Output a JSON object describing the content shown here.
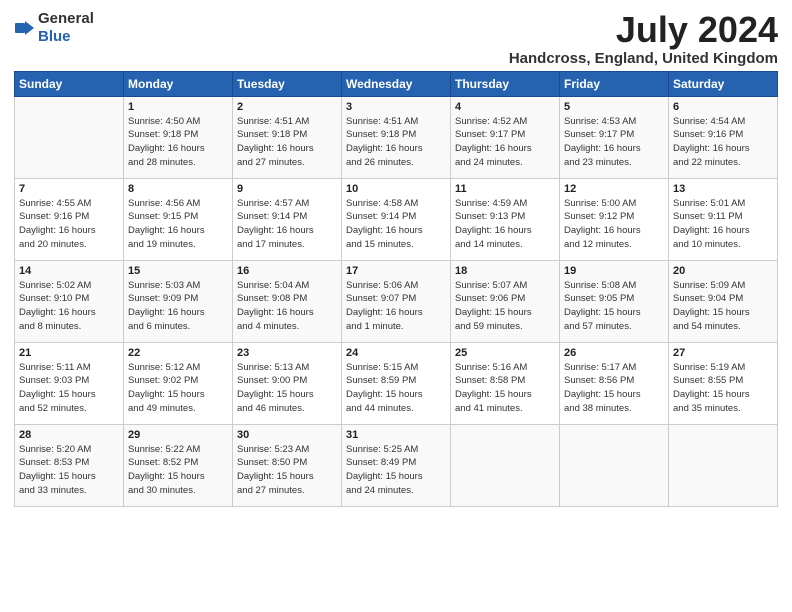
{
  "header": {
    "logo_general": "General",
    "logo_blue": "Blue",
    "title": "July 2024",
    "location": "Handcross, England, United Kingdom"
  },
  "columns": [
    "Sunday",
    "Monday",
    "Tuesday",
    "Wednesday",
    "Thursday",
    "Friday",
    "Saturday"
  ],
  "weeks": [
    [
      {
        "day": "",
        "info": ""
      },
      {
        "day": "1",
        "info": "Sunrise: 4:50 AM\nSunset: 9:18 PM\nDaylight: 16 hours\nand 28 minutes."
      },
      {
        "day": "2",
        "info": "Sunrise: 4:51 AM\nSunset: 9:18 PM\nDaylight: 16 hours\nand 27 minutes."
      },
      {
        "day": "3",
        "info": "Sunrise: 4:51 AM\nSunset: 9:18 PM\nDaylight: 16 hours\nand 26 minutes."
      },
      {
        "day": "4",
        "info": "Sunrise: 4:52 AM\nSunset: 9:17 PM\nDaylight: 16 hours\nand 24 minutes."
      },
      {
        "day": "5",
        "info": "Sunrise: 4:53 AM\nSunset: 9:17 PM\nDaylight: 16 hours\nand 23 minutes."
      },
      {
        "day": "6",
        "info": "Sunrise: 4:54 AM\nSunset: 9:16 PM\nDaylight: 16 hours\nand 22 minutes."
      }
    ],
    [
      {
        "day": "7",
        "info": "Sunrise: 4:55 AM\nSunset: 9:16 PM\nDaylight: 16 hours\nand 20 minutes."
      },
      {
        "day": "8",
        "info": "Sunrise: 4:56 AM\nSunset: 9:15 PM\nDaylight: 16 hours\nand 19 minutes."
      },
      {
        "day": "9",
        "info": "Sunrise: 4:57 AM\nSunset: 9:14 PM\nDaylight: 16 hours\nand 17 minutes."
      },
      {
        "day": "10",
        "info": "Sunrise: 4:58 AM\nSunset: 9:14 PM\nDaylight: 16 hours\nand 15 minutes."
      },
      {
        "day": "11",
        "info": "Sunrise: 4:59 AM\nSunset: 9:13 PM\nDaylight: 16 hours\nand 14 minutes."
      },
      {
        "day": "12",
        "info": "Sunrise: 5:00 AM\nSunset: 9:12 PM\nDaylight: 16 hours\nand 12 minutes."
      },
      {
        "day": "13",
        "info": "Sunrise: 5:01 AM\nSunset: 9:11 PM\nDaylight: 16 hours\nand 10 minutes."
      }
    ],
    [
      {
        "day": "14",
        "info": "Sunrise: 5:02 AM\nSunset: 9:10 PM\nDaylight: 16 hours\nand 8 minutes."
      },
      {
        "day": "15",
        "info": "Sunrise: 5:03 AM\nSunset: 9:09 PM\nDaylight: 16 hours\nand 6 minutes."
      },
      {
        "day": "16",
        "info": "Sunrise: 5:04 AM\nSunset: 9:08 PM\nDaylight: 16 hours\nand 4 minutes."
      },
      {
        "day": "17",
        "info": "Sunrise: 5:06 AM\nSunset: 9:07 PM\nDaylight: 16 hours\nand 1 minute."
      },
      {
        "day": "18",
        "info": "Sunrise: 5:07 AM\nSunset: 9:06 PM\nDaylight: 15 hours\nand 59 minutes."
      },
      {
        "day": "19",
        "info": "Sunrise: 5:08 AM\nSunset: 9:05 PM\nDaylight: 15 hours\nand 57 minutes."
      },
      {
        "day": "20",
        "info": "Sunrise: 5:09 AM\nSunset: 9:04 PM\nDaylight: 15 hours\nand 54 minutes."
      }
    ],
    [
      {
        "day": "21",
        "info": "Sunrise: 5:11 AM\nSunset: 9:03 PM\nDaylight: 15 hours\nand 52 minutes."
      },
      {
        "day": "22",
        "info": "Sunrise: 5:12 AM\nSunset: 9:02 PM\nDaylight: 15 hours\nand 49 minutes."
      },
      {
        "day": "23",
        "info": "Sunrise: 5:13 AM\nSunset: 9:00 PM\nDaylight: 15 hours\nand 46 minutes."
      },
      {
        "day": "24",
        "info": "Sunrise: 5:15 AM\nSunset: 8:59 PM\nDaylight: 15 hours\nand 44 minutes."
      },
      {
        "day": "25",
        "info": "Sunrise: 5:16 AM\nSunset: 8:58 PM\nDaylight: 15 hours\nand 41 minutes."
      },
      {
        "day": "26",
        "info": "Sunrise: 5:17 AM\nSunset: 8:56 PM\nDaylight: 15 hours\nand 38 minutes."
      },
      {
        "day": "27",
        "info": "Sunrise: 5:19 AM\nSunset: 8:55 PM\nDaylight: 15 hours\nand 35 minutes."
      }
    ],
    [
      {
        "day": "28",
        "info": "Sunrise: 5:20 AM\nSunset: 8:53 PM\nDaylight: 15 hours\nand 33 minutes."
      },
      {
        "day": "29",
        "info": "Sunrise: 5:22 AM\nSunset: 8:52 PM\nDaylight: 15 hours\nand 30 minutes."
      },
      {
        "day": "30",
        "info": "Sunrise: 5:23 AM\nSunset: 8:50 PM\nDaylight: 15 hours\nand 27 minutes."
      },
      {
        "day": "31",
        "info": "Sunrise: 5:25 AM\nSunset: 8:49 PM\nDaylight: 15 hours\nand 24 minutes."
      },
      {
        "day": "",
        "info": ""
      },
      {
        "day": "",
        "info": ""
      },
      {
        "day": "",
        "info": ""
      }
    ]
  ]
}
